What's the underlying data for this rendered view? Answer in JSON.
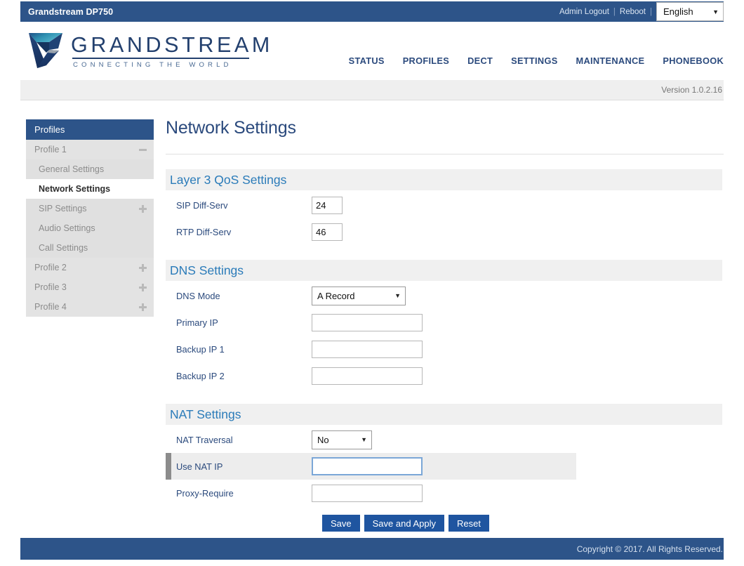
{
  "titlebar": {
    "device_name": "Grandstream DP750",
    "admin_logout": "Admin Logout",
    "separator": "|",
    "reboot": "Reboot",
    "separator2": "|",
    "language": "English",
    "caret": "▼"
  },
  "brand": {
    "wordmark": "GRANDSTREAM",
    "tagline": "CONNECTING THE WORLD"
  },
  "nav": {
    "items": [
      {
        "label": "STATUS"
      },
      {
        "label": "PROFILES"
      },
      {
        "label": "DECT"
      },
      {
        "label": "SETTINGS"
      },
      {
        "label": "MAINTENANCE"
      },
      {
        "label": "PHONEBOOK"
      }
    ]
  },
  "version_bar": {
    "text": "Version 1.0.2.16"
  },
  "sidebar": {
    "header": "Profiles",
    "items": [
      {
        "label": "Profile 1",
        "icon": "minus",
        "level": 1,
        "active": false
      },
      {
        "label": "General Settings",
        "icon": "",
        "level": 2,
        "active": false
      },
      {
        "label": "Network Settings",
        "icon": "",
        "level": 2,
        "active": true
      },
      {
        "label": "SIP Settings",
        "icon": "plus",
        "level": 2,
        "active": false
      },
      {
        "label": "Audio Settings",
        "icon": "",
        "level": 2,
        "active": false
      },
      {
        "label": "Call Settings",
        "icon": "",
        "level": 2,
        "active": false
      },
      {
        "label": "Profile 2",
        "icon": "plus",
        "level": 1,
        "active": false
      },
      {
        "label": "Profile 3",
        "icon": "plus",
        "level": 1,
        "active": false
      },
      {
        "label": "Profile 4",
        "icon": "plus",
        "level": 1,
        "active": false
      }
    ]
  },
  "main": {
    "page_title": "Network Settings",
    "sections": {
      "qos": {
        "title": "Layer 3 QoS Settings",
        "sip_diffserv_label": "SIP Diff-Serv",
        "sip_diffserv_value": "24",
        "rtp_diffserv_label": "RTP Diff-Serv",
        "rtp_diffserv_value": "46"
      },
      "dns": {
        "title": "DNS Settings",
        "dns_mode_label": "DNS Mode",
        "dns_mode_value": "A Record",
        "primary_ip_label": "Primary IP",
        "primary_ip_value": "",
        "backup_ip1_label": "Backup IP 1",
        "backup_ip1_value": "",
        "backup_ip2_label": "Backup IP 2",
        "backup_ip2_value": ""
      },
      "nat": {
        "title": "NAT Settings",
        "nat_traversal_label": "NAT Traversal",
        "nat_traversal_value": "No",
        "use_nat_ip_label": "Use NAT IP",
        "use_nat_ip_value": "",
        "proxy_require_label": "Proxy-Require",
        "proxy_require_value": ""
      }
    },
    "buttons": {
      "save": "Save",
      "save_and_apply": "Save and Apply",
      "reset": "Reset"
    },
    "caret": "▼"
  },
  "footer": {
    "copyright": "Copyright © 2017. All Rights Reserved."
  },
  "colors": {
    "header_blue": "#2d5489",
    "section_blue": "#2a7bb9",
    "button_blue": "#1f55a0",
    "label_blue": "#2b4a7d",
    "focus_border": "#7ba7d7"
  }
}
